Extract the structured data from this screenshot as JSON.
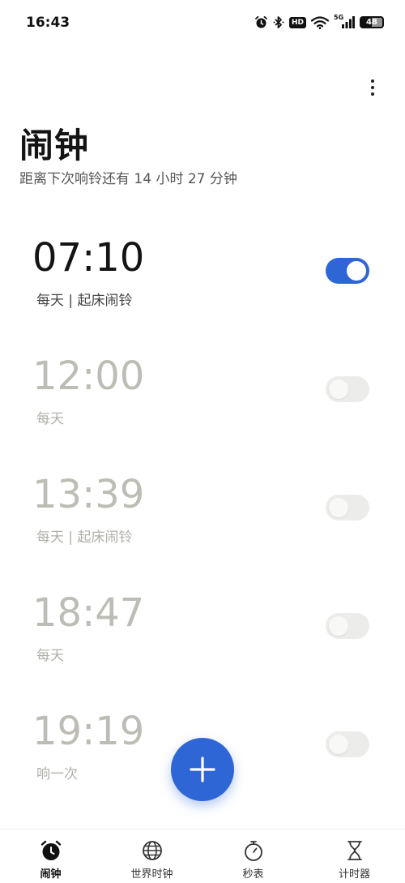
{
  "status_bar": {
    "time": "16:43",
    "hd_label": "HD",
    "network_label": "5G",
    "battery": "48",
    "icons": [
      "alarm-icon",
      "bluetooth-icon",
      "hd-icon",
      "wifi-icon",
      "signal-5g-icon",
      "battery-icon"
    ]
  },
  "header": {
    "title": "闹钟",
    "next_alarm": "距离下次响铃还有 14 小时 27 分钟"
  },
  "alarms": [
    {
      "time": "07:10",
      "label": "每天 | 起床闹铃",
      "enabled": true
    },
    {
      "time": "12:00",
      "label": "每天",
      "enabled": false
    },
    {
      "time": "13:39",
      "label": "每天 | 起床闹铃",
      "enabled": false
    },
    {
      "time": "18:47",
      "label": "每天",
      "enabled": false
    },
    {
      "time": "19:19",
      "label": "响一次",
      "enabled": false
    }
  ],
  "bottom_nav": {
    "items": [
      {
        "label": "闹钟",
        "icon": "alarm-clock-icon",
        "active": true
      },
      {
        "label": "世界时钟",
        "icon": "globe-icon",
        "active": false
      },
      {
        "label": "秒表",
        "icon": "stopwatch-icon",
        "active": false
      },
      {
        "label": "计时器",
        "icon": "hourglass-icon",
        "active": false
      }
    ]
  },
  "colors": {
    "accent": "#2f66d6",
    "toggle_off": "#ececea",
    "disabled_text": "#bdbdb5"
  }
}
